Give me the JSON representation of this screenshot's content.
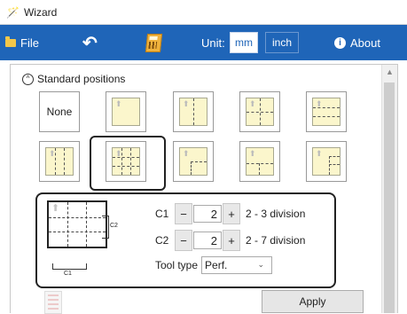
{
  "window": {
    "title": "Wizard"
  },
  "toolbar": {
    "file_label": "File",
    "unit_label": "Unit:",
    "unit_mm": "mm",
    "unit_inch": "inch",
    "about_label": "About",
    "info_glyph": "i",
    "selected_unit": "mm"
  },
  "section": {
    "title": "Standard positions",
    "none_label": "None",
    "toggle_glyph": "^",
    "selected_tile": 6
  },
  "detail": {
    "c1_label": "C1",
    "c1_value": "2",
    "c1_hint": "2 - 3 division",
    "c2_label": "C2",
    "c2_value": "2",
    "c2_hint": "2 - 7 division",
    "minus": "−",
    "plus": "+",
    "tool_type_label": "Tool type",
    "tool_type_value": "Perf.",
    "diagram_c1": "C1",
    "diagram_c2": "C2"
  },
  "apply_label": "Apply",
  "icons": {
    "app": "wizard-icon",
    "file": "folder-icon",
    "undo": "undo-icon",
    "calc": "calculator-icon",
    "about": "info-icon",
    "collapse": "chevron-up-circle-icon",
    "arrow_up": "up-arrow-icon",
    "scroll_up": "scroll-up-icon",
    "dropdown": "chevron-down-icon"
  },
  "colors": {
    "toolbar_bg": "#1f65b8",
    "tile_paper": "#fbf6cc",
    "selected_border": "#222222"
  }
}
